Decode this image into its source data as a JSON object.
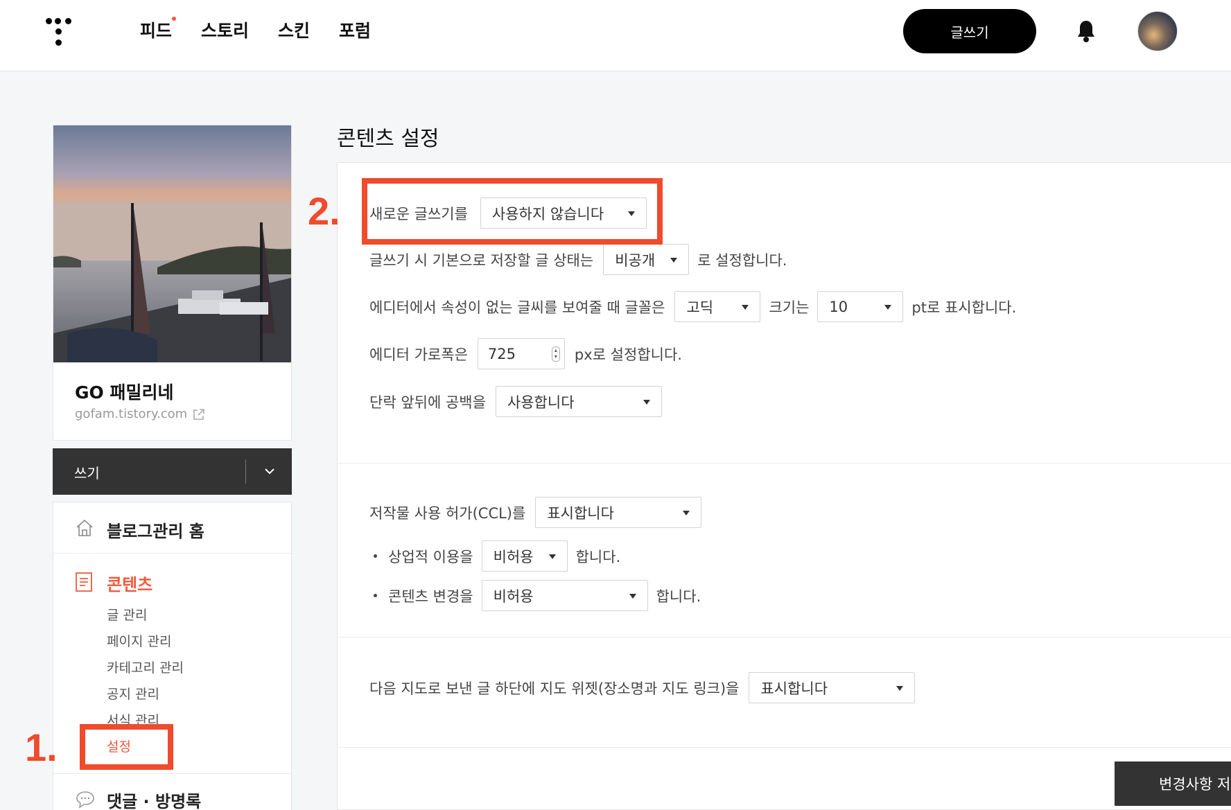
{
  "header": {
    "nav": [
      "피드",
      "스토리",
      "스킨",
      "포럼"
    ],
    "write_label": "글쓰기"
  },
  "sidebar": {
    "blog_name": "GO 패밀리네",
    "blog_url": "gofam.tistory.com",
    "write_bar_label": "쓰기",
    "home_label": "블로그관리 홈",
    "content_label": "콘텐츠",
    "submenu": [
      "글 관리",
      "페이지 관리",
      "카테고리 관리",
      "공지 관리",
      "서식 관리",
      "설정"
    ],
    "comments_label": "댓글 · 방명록"
  },
  "main": {
    "title": "콘텐츠 설정",
    "editor": {
      "new_editor_label": "새로운 글쓰기를",
      "new_editor_value": "사용하지 않습니다",
      "save_state_prefix": "글쓰기 시 기본으로 저장할 글 상태는",
      "save_state_value": "비공개",
      "save_state_suffix": "로 설정합니다.",
      "font_prefix": "에디터에서 속성이 없는 글씨를 보여줄 때 글꼴은",
      "font_value": "고딕",
      "size_label": "크기는",
      "size_value": "10",
      "size_suffix": "pt로 표시합니다.",
      "width_label": "에디터 가로폭은",
      "width_value": "725",
      "width_suffix": "px로 설정합니다.",
      "spacing_label": "단락 앞뒤에 공백을",
      "spacing_value": "사용합니다"
    },
    "ccl": {
      "label": "저작물 사용 허가(CCL)를",
      "value": "표시합니다",
      "commercial_label": "상업적 이용을",
      "commercial_value": "비허용",
      "commercial_suffix": "합니다.",
      "modify_label": "콘텐츠 변경을",
      "modify_value": "비허용",
      "modify_suffix": "합니다."
    },
    "map": {
      "label": "다음 지도로 보낸 글 하단에 지도 위젯(장소명과 지도 링크)을",
      "value": "표시합니다"
    },
    "save_label": "변경사항 저장"
  },
  "annotations": {
    "step1": "1.",
    "step2": "2."
  },
  "colors": {
    "accent": "#ef5a3c",
    "annotation": "#ef4b2c",
    "dark": "#333333"
  }
}
